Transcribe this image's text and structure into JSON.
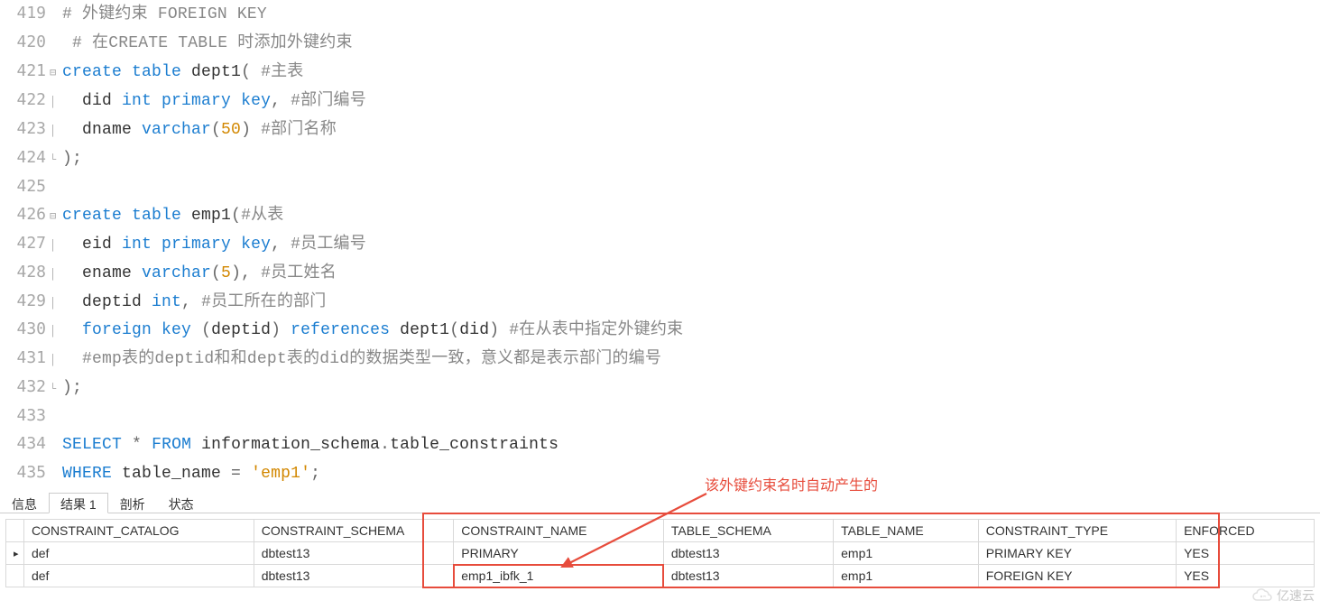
{
  "editor": {
    "lines": [
      {
        "num": "419",
        "fold": "",
        "tokens": [
          {
            "t": "#",
            "c": "cm"
          },
          {
            "t": " 外键约束 FOREIGN KEY",
            "c": "cm"
          }
        ]
      },
      {
        "num": "420",
        "fold": "",
        "tokens": [
          {
            "t": " ",
            "c": "id"
          },
          {
            "t": "#",
            "c": "cm"
          },
          {
            "t": " 在CREATE TABLE 时添加外键约束",
            "c": "cm"
          }
        ]
      },
      {
        "num": "421",
        "fold": "⊟",
        "tokens": [
          {
            "t": "create",
            "c": "kw"
          },
          {
            "t": " ",
            "c": "id"
          },
          {
            "t": "table",
            "c": "kw"
          },
          {
            "t": " dept1",
            "c": "id"
          },
          {
            "t": "(",
            "c": "pn"
          },
          {
            "t": " ",
            "c": "id"
          },
          {
            "t": "#主表",
            "c": "cm"
          }
        ]
      },
      {
        "num": "422",
        "fold": "│",
        "tokens": [
          {
            "t": "  did ",
            "c": "id"
          },
          {
            "t": "int",
            "c": "ty"
          },
          {
            "t": " ",
            "c": "id"
          },
          {
            "t": "primary",
            "c": "kw"
          },
          {
            "t": " ",
            "c": "id"
          },
          {
            "t": "key",
            "c": "kw"
          },
          {
            "t": ",",
            "c": "pn"
          },
          {
            "t": " ",
            "c": "id"
          },
          {
            "t": "#部门编号",
            "c": "cm"
          }
        ]
      },
      {
        "num": "423",
        "fold": "│",
        "tokens": [
          {
            "t": "  dname ",
            "c": "id"
          },
          {
            "t": "varchar",
            "c": "ty"
          },
          {
            "t": "(",
            "c": "pn"
          },
          {
            "t": "50",
            "c": "num"
          },
          {
            "t": ")",
            "c": "pn"
          },
          {
            "t": " ",
            "c": "id"
          },
          {
            "t": "#部门名称",
            "c": "cm"
          }
        ]
      },
      {
        "num": "424",
        "fold": "└",
        "tokens": [
          {
            "t": ")",
            "c": "pn"
          },
          {
            "t": ";",
            "c": "pn"
          }
        ]
      },
      {
        "num": "425",
        "fold": "",
        "tokens": [
          {
            "t": "",
            "c": "id"
          }
        ]
      },
      {
        "num": "426",
        "fold": "⊟",
        "tokens": [
          {
            "t": "create",
            "c": "kw"
          },
          {
            "t": " ",
            "c": "id"
          },
          {
            "t": "table",
            "c": "kw"
          },
          {
            "t": " emp1",
            "c": "id"
          },
          {
            "t": "(",
            "c": "pn"
          },
          {
            "t": "#从表",
            "c": "cm"
          }
        ]
      },
      {
        "num": "427",
        "fold": "│",
        "tokens": [
          {
            "t": "  eid ",
            "c": "id"
          },
          {
            "t": "int",
            "c": "ty"
          },
          {
            "t": " ",
            "c": "id"
          },
          {
            "t": "primary",
            "c": "kw"
          },
          {
            "t": " ",
            "c": "id"
          },
          {
            "t": "key",
            "c": "kw"
          },
          {
            "t": ",",
            "c": "pn"
          },
          {
            "t": " ",
            "c": "id"
          },
          {
            "t": "#员工编号",
            "c": "cm"
          }
        ]
      },
      {
        "num": "428",
        "fold": "│",
        "tokens": [
          {
            "t": "  ename ",
            "c": "id"
          },
          {
            "t": "varchar",
            "c": "ty"
          },
          {
            "t": "(",
            "c": "pn"
          },
          {
            "t": "5",
            "c": "num"
          },
          {
            "t": ")",
            "c": "pn"
          },
          {
            "t": ",",
            "c": "pn"
          },
          {
            "t": " ",
            "c": "id"
          },
          {
            "t": "#员工姓名",
            "c": "cm"
          }
        ]
      },
      {
        "num": "429",
        "fold": "│",
        "tokens": [
          {
            "t": "  deptid ",
            "c": "id"
          },
          {
            "t": "int",
            "c": "ty"
          },
          {
            "t": ",",
            "c": "pn"
          },
          {
            "t": " ",
            "c": "id"
          },
          {
            "t": "#员工所在的部门",
            "c": "cm"
          }
        ]
      },
      {
        "num": "430",
        "fold": "│",
        "tokens": [
          {
            "t": "  ",
            "c": "id"
          },
          {
            "t": "foreign",
            "c": "kw"
          },
          {
            "t": " ",
            "c": "id"
          },
          {
            "t": "key",
            "c": "kw"
          },
          {
            "t": " ",
            "c": "id"
          },
          {
            "t": "(",
            "c": "pn"
          },
          {
            "t": "deptid",
            "c": "id"
          },
          {
            "t": ")",
            "c": "pn"
          },
          {
            "t": " ",
            "c": "id"
          },
          {
            "t": "references",
            "c": "kw"
          },
          {
            "t": " dept1",
            "c": "id"
          },
          {
            "t": "(",
            "c": "pn"
          },
          {
            "t": "did",
            "c": "id"
          },
          {
            "t": ")",
            "c": "pn"
          },
          {
            "t": " ",
            "c": "id"
          },
          {
            "t": "#在从表中指定外键约束",
            "c": "cm"
          }
        ]
      },
      {
        "num": "431",
        "fold": "│",
        "tokens": [
          {
            "t": "  ",
            "c": "id"
          },
          {
            "t": "#emp表的deptid和和dept表的did的数据类型一致，意义都是表示部门的编号",
            "c": "cm"
          }
        ]
      },
      {
        "num": "432",
        "fold": "└",
        "tokens": [
          {
            "t": ")",
            "c": "pn"
          },
          {
            "t": ";",
            "c": "pn"
          }
        ]
      },
      {
        "num": "433",
        "fold": "",
        "tokens": [
          {
            "t": "",
            "c": "id"
          }
        ]
      },
      {
        "num": "434",
        "fold": "",
        "tokens": [
          {
            "t": "SELECT",
            "c": "kw"
          },
          {
            "t": " ",
            "c": "id"
          },
          {
            "t": "*",
            "c": "pn"
          },
          {
            "t": " ",
            "c": "id"
          },
          {
            "t": "FROM",
            "c": "kw"
          },
          {
            "t": " information_schema",
            "c": "id"
          },
          {
            "t": ".",
            "c": "pn"
          },
          {
            "t": "table_constraints",
            "c": "id"
          }
        ]
      },
      {
        "num": "435",
        "fold": "",
        "tokens": [
          {
            "t": "WHERE",
            "c": "kw"
          },
          {
            "t": " table_name ",
            "c": "id"
          },
          {
            "t": "=",
            "c": "pn"
          },
          {
            "t": " ",
            "c": "id"
          },
          {
            "t": "'emp1'",
            "c": "str"
          },
          {
            "t": ";",
            "c": "pn"
          }
        ]
      }
    ]
  },
  "tabs": {
    "items": [
      {
        "label": "信息",
        "active": false
      },
      {
        "label": "结果 1",
        "active": true
      },
      {
        "label": "剖析",
        "active": false
      },
      {
        "label": "状态",
        "active": false
      }
    ]
  },
  "grid": {
    "columns": [
      "CONSTRAINT_CATALOG",
      "CONSTRAINT_SCHEMA",
      "CONSTRAINT_NAME",
      "TABLE_SCHEMA",
      "TABLE_NAME",
      "CONSTRAINT_TYPE",
      "ENFORCED"
    ],
    "widths": [
      230,
      200,
      210,
      170,
      145,
      198,
      138
    ],
    "rows": [
      {
        "indicator": "▸",
        "cells": [
          "def",
          "dbtest13",
          "PRIMARY",
          "dbtest13",
          "emp1",
          "PRIMARY KEY",
          "YES"
        ]
      },
      {
        "indicator": "",
        "cells": [
          "def",
          "dbtest13",
          "emp1_ibfk_1",
          "dbtest13",
          "emp1",
          "FOREIGN KEY",
          "YES"
        ]
      }
    ]
  },
  "annotation": {
    "text": "该外键约束名时自动产生的"
  },
  "watermark": {
    "text": "亿速云"
  }
}
